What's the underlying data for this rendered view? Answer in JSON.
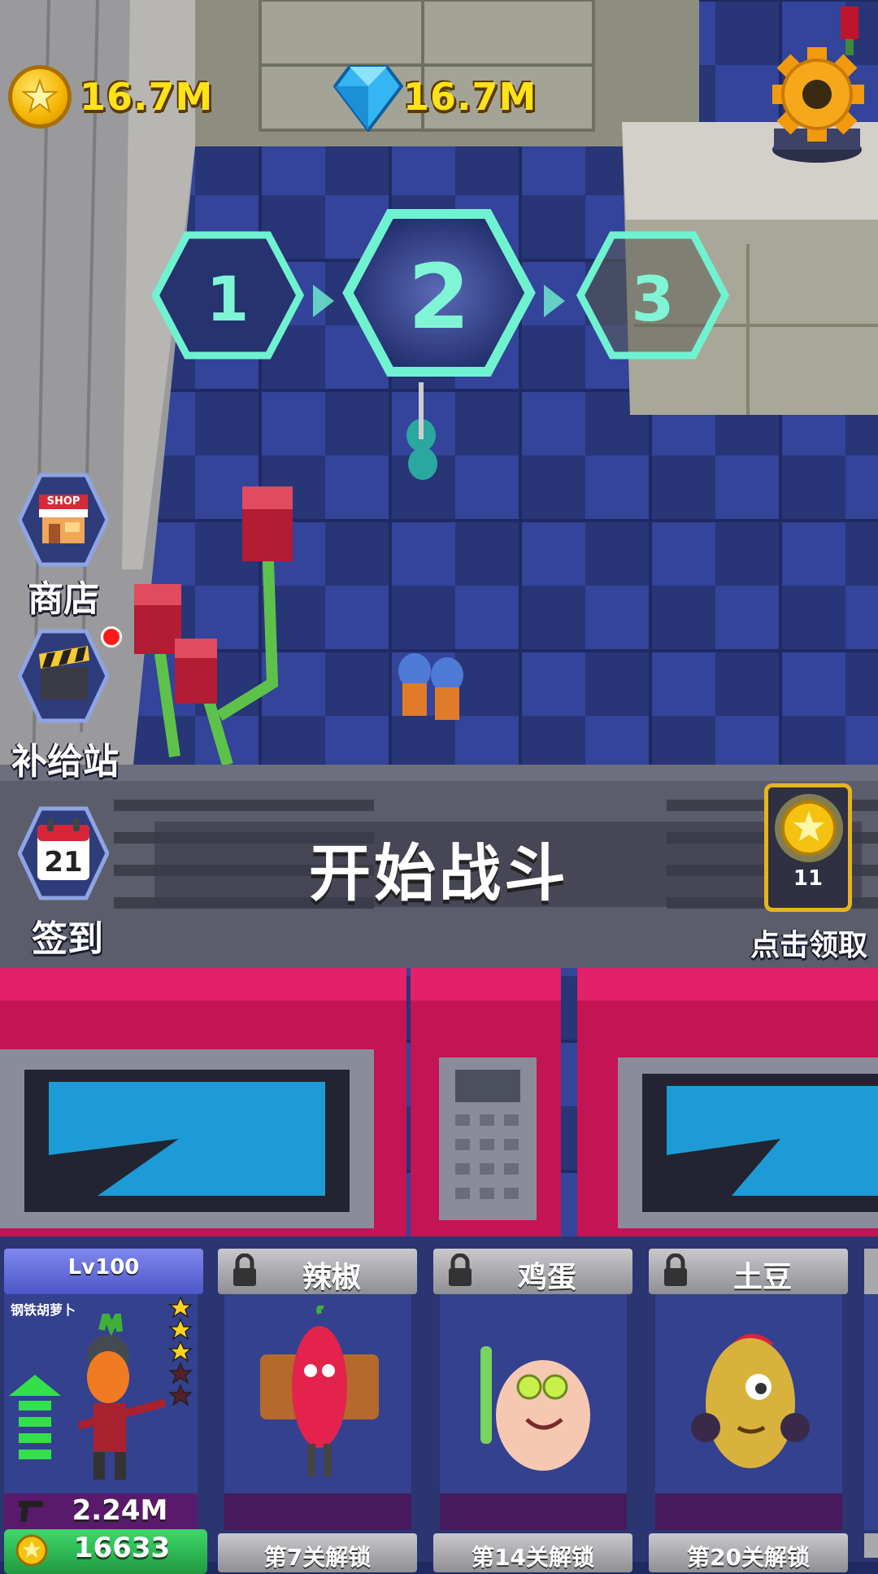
{
  "hud": {
    "gold_amount": "16.7M",
    "gem_amount": "16.7M",
    "settings_icon": "gear-icon"
  },
  "stages": {
    "items": [
      "1",
      "2",
      "3"
    ],
    "current": "2"
  },
  "side_menu": {
    "shop_label": "商店",
    "shop_sign": "SHOP",
    "supply_label": "补给站",
    "checkin_label": "签到",
    "checkin_day": "21"
  },
  "start": {
    "label": "开始战斗"
  },
  "reward": {
    "count": "11",
    "label": "点击领取"
  },
  "heroes": {
    "selected": {
      "level": "Lv100",
      "name": "钢铁胡萝卜",
      "stars_filled": 3,
      "stars_total": 5,
      "power": "2.24M",
      "upgrade_cost": "16633"
    },
    "locked": [
      {
        "name": "辣椒",
        "unlock": "第7关解锁"
      },
      {
        "name": "鸡蛋",
        "unlock": "第14关解锁"
      },
      {
        "name": "土豆",
        "unlock": "第20关解锁"
      }
    ]
  },
  "colors": {
    "accent_teal": "#6ff2d0",
    "gold": "#ffe21a",
    "floor_blue": "#2c3a86",
    "microwave_pink": "#d8195e"
  }
}
